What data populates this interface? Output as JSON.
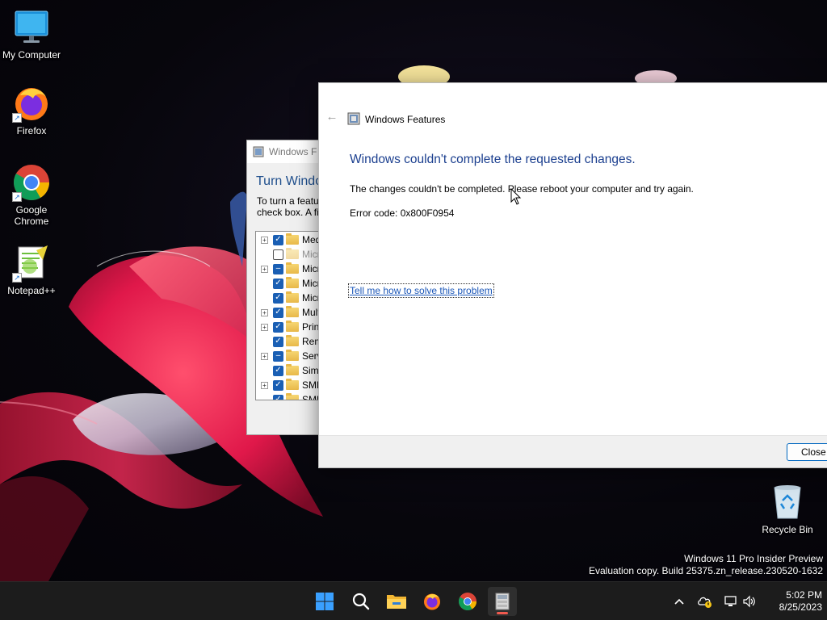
{
  "desktop": {
    "icons": [
      {
        "label": "My Computer"
      },
      {
        "label": "Firefox"
      },
      {
        "label": "Google Chrome"
      },
      {
        "label": "Notepad++"
      },
      {
        "label": "Recycle Bin"
      }
    ],
    "watermark": {
      "line1": "Windows 11 Pro Insider Preview",
      "line2": "Evaluation copy. Build 25375.zn_release.230520-1632"
    }
  },
  "background_window": {
    "title": "Windows F",
    "heading": "Turn Windo",
    "desc_line1": "To turn a featu",
    "desc_line2": "check box. A fi",
    "features": [
      {
        "label": "Med",
        "state": "checked",
        "expandable": true
      },
      {
        "label": "Micr",
        "state": "unchecked",
        "expandable": false
      },
      {
        "label": "Micr",
        "state": "partial",
        "expandable": true
      },
      {
        "label": "Micr",
        "state": "checked",
        "expandable": false
      },
      {
        "label": "Micr",
        "state": "checked",
        "expandable": false
      },
      {
        "label": "Mult",
        "state": "checked",
        "expandable": true
      },
      {
        "label": "Print",
        "state": "checked",
        "expandable": true
      },
      {
        "label": "Rem",
        "state": "checked",
        "expandable": false
      },
      {
        "label": "Serv",
        "state": "partial",
        "expandable": true
      },
      {
        "label": "Simp",
        "state": "checked",
        "expandable": false
      },
      {
        "label": "SMB",
        "state": "checked",
        "expandable": true
      },
      {
        "label": "SMB",
        "state": "checked",
        "expandable": false
      }
    ]
  },
  "dialog": {
    "title": "Windows Features",
    "heading": "Windows couldn't complete the requested changes.",
    "message": "The changes couldn't be completed. Please reboot your computer and try again.",
    "error": "Error code: 0x800F0954",
    "link": "Tell me how to solve this problem",
    "close_label": "Close"
  },
  "taskbar": {
    "apps": [
      "start-icon",
      "search-icon",
      "file-explorer-icon",
      "firefox-icon",
      "chrome-icon",
      "windows-features-icon"
    ],
    "clock_time": "5:02 PM",
    "clock_date": "8/25/2023"
  }
}
